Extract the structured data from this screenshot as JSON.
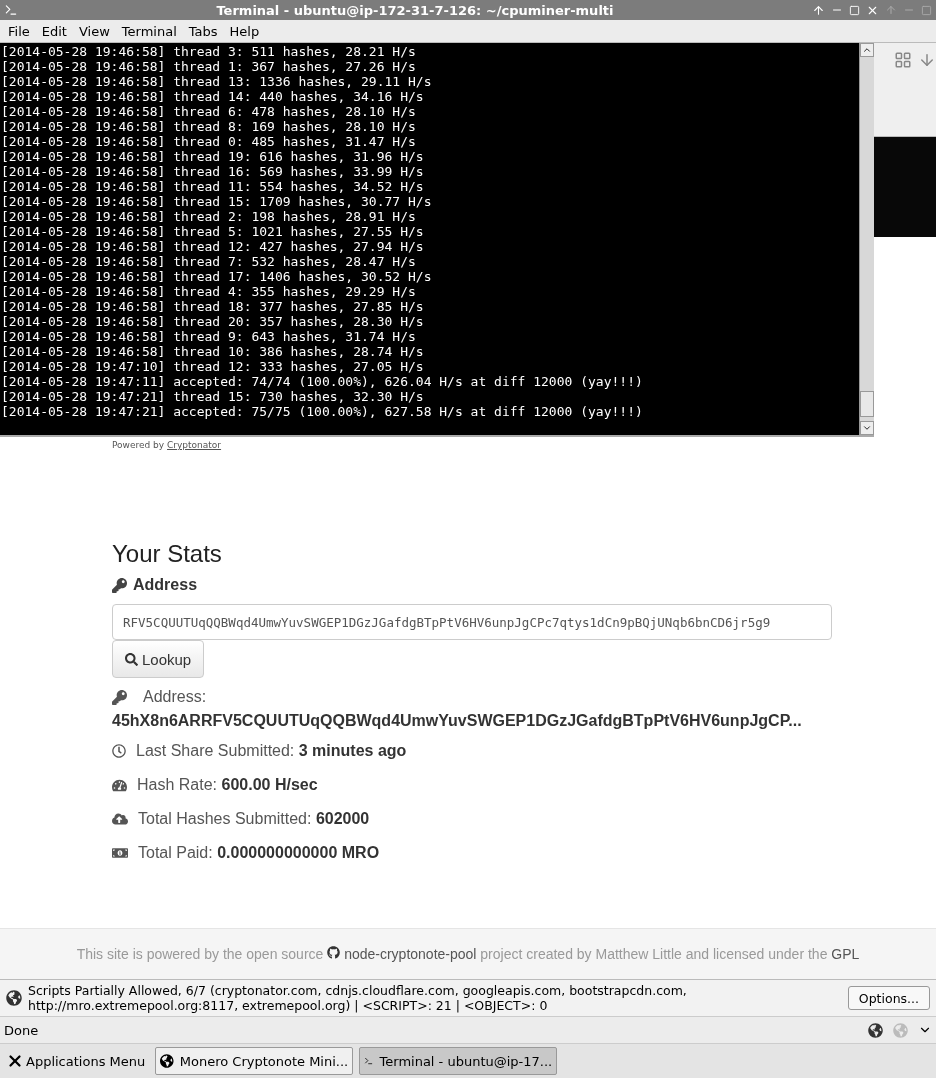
{
  "window": {
    "title": "Terminal - ubuntu@ip-172-31-7-126: ~/cpuminer-multi"
  },
  "menu": [
    "File",
    "Edit",
    "View",
    "Terminal",
    "Tabs",
    "Help"
  ],
  "terminal": {
    "lines": [
      "[2014-05-28 19:46:58] thread 3: 511 hashes, 28.21 H/s",
      "[2014-05-28 19:46:58] thread 1: 367 hashes, 27.26 H/s",
      "[2014-05-28 19:46:58] thread 13: 1336 hashes, 29.11 H/s",
      "[2014-05-28 19:46:58] thread 14: 440 hashes, 34.16 H/s",
      "[2014-05-28 19:46:58] thread 6: 478 hashes, 28.10 H/s",
      "[2014-05-28 19:46:58] thread 8: 169 hashes, 28.10 H/s",
      "[2014-05-28 19:46:58] thread 0: 485 hashes, 31.47 H/s",
      "[2014-05-28 19:46:58] thread 19: 616 hashes, 31.96 H/s",
      "[2014-05-28 19:46:58] thread 16: 569 hashes, 33.99 H/s",
      "[2014-05-28 19:46:58] thread 11: 554 hashes, 34.52 H/s",
      "[2014-05-28 19:46:58] thread 15: 1709 hashes, 30.77 H/s",
      "[2014-05-28 19:46:58] thread 2: 198 hashes, 28.91 H/s",
      "[2014-05-28 19:46:58] thread 5: 1021 hashes, 27.55 H/s",
      "[2014-05-28 19:46:58] thread 12: 427 hashes, 27.94 H/s",
      "[2014-05-28 19:46:58] thread 7: 532 hashes, 28.47 H/s",
      "[2014-05-28 19:46:58] thread 17: 1406 hashes, 30.52 H/s",
      "[2014-05-28 19:46:58] thread 4: 355 hashes, 29.29 H/s",
      "[2014-05-28 19:46:58] thread 18: 377 hashes, 27.85 H/s",
      "[2014-05-28 19:46:58] thread 20: 357 hashes, 28.30 H/s",
      "[2014-05-28 19:46:58] thread 9: 643 hashes, 31.74 H/s",
      "[2014-05-28 19:46:58] thread 10: 386 hashes, 28.74 H/s",
      "[2014-05-28 19:47:10] thread 12: 333 hashes, 27.05 H/s",
      "[2014-05-28 19:47:11] accepted: 74/74 (100.00%), 626.04 H/s at diff 12000 (yay!!!)",
      "[2014-05-28 19:47:21] thread 15: 730 hashes, 32.30 H/s",
      "[2014-05-28 19:47:21] accepted: 75/75 (100.00%), 627.58 H/s at diff 12000 (yay!!!)"
    ]
  },
  "page": {
    "powered_by": {
      "text": "Powered by",
      "link": "Cryptonator"
    },
    "stats": {
      "heading": "Your Stats",
      "address_label": "Address",
      "address_value": "RFV5CQUUTUqQQBWqd4UmwYuvSWGEP1DGzJGafdgBTpPtV6HV6unpJgCPc7qtys1dCn9pBQjUNqb6bnCD6jr5g9",
      "lookup_button": "Lookup",
      "items": [
        {
          "kind": "address",
          "label": "Address:",
          "value": "45hX8n6ARRFV5CQUUTUqQQBWqd4UmwYuvSWGEP1DGzJGafdgBTpPtV6HV6unpJgCP..."
        },
        {
          "kind": "clock",
          "label": "Last Share Submitted:",
          "value": "3 minutes ago"
        },
        {
          "kind": "gauge",
          "label": "Hash Rate:",
          "value": "600.00 H/sec"
        },
        {
          "kind": "upload",
          "label": "Total Hashes Submitted:",
          "value": "602000"
        },
        {
          "kind": "money",
          "label": "Total Paid:",
          "value": "0.000000000000 MRO"
        }
      ]
    },
    "footer": {
      "text_1": "This site is powered by the open source",
      "link_1": "node-cryptonote-pool",
      "text_2": "project created by Matthew Little and licensed under the",
      "link_2": "GPL"
    }
  },
  "noscript": {
    "lines": [
      "Scripts Partially Allowed, 6/7 (cryptonator.com, cdnjs.cloudflare.com, googleapis.com, bootstrapcdn.com,",
      "http://mro.extremepool.org:8117, extremepool.org) | <SCRIPT>: 21 | <OBJECT>: 0"
    ],
    "button": "Options..."
  },
  "status": "Done",
  "taskbar": {
    "menu": "Applications Menu",
    "tasks": [
      {
        "label": "Monero Cryptonote Mini...",
        "kind": "browser",
        "selected": false
      },
      {
        "label": "Terminal - ubuntu@ip-17...",
        "kind": "terminal",
        "selected": true
      }
    ]
  }
}
